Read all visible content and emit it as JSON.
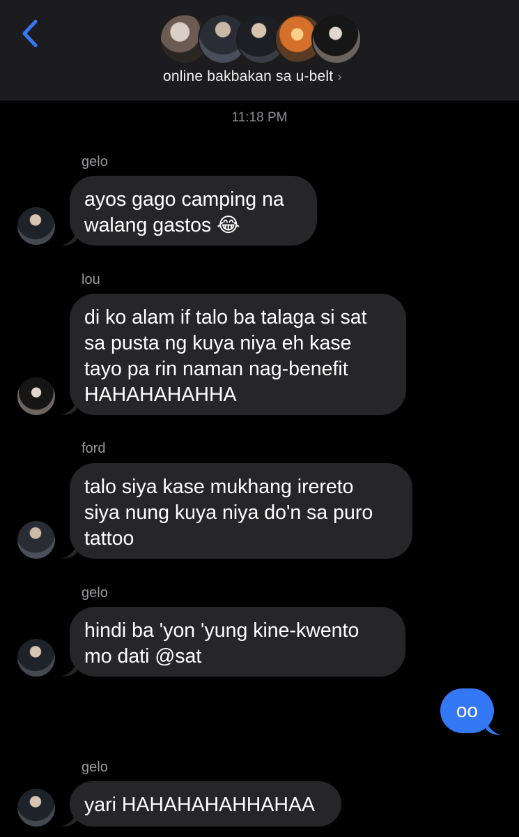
{
  "header": {
    "group_name": "online bakbakan sa u-belt",
    "chevron": "›",
    "back_icon": "chevron-left-icon",
    "accent": "#3478f6"
  },
  "thread": {
    "timestamp": "11:18 PM",
    "messages": [
      {
        "sender": "gelo",
        "text": "ayos gago camping na\nwalang gastos 😂"
      },
      {
        "sender": "lou",
        "text": "di ko alam if talo ba talaga si sat\nsa pusta ng kuya niya eh kase\ntayo pa rin naman nag-benefit\nHAHAHAHAHHA"
      },
      {
        "sender": "ford",
        "text": "talo siya kase mukhang irereto\nsiya nung kuya niya do'n sa puro\ntattoo"
      },
      {
        "sender": "gelo",
        "text": "hindi ba 'yon 'yung kine-kwento\nmo dati @sat"
      },
      {
        "sender": "me",
        "text": "oo"
      },
      {
        "sender": "gelo",
        "text": "yari HAHAHAHAHHAHAA"
      }
    ]
  },
  "colors": {
    "incoming_bubble": "#262628",
    "outgoing_bubble": "#3478f6",
    "header_bg": "#1c1c1e"
  }
}
